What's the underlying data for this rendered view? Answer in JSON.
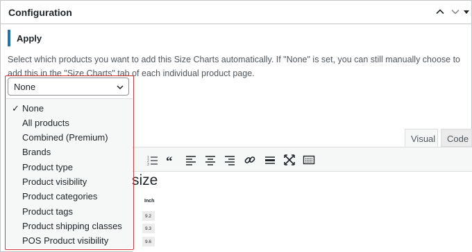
{
  "panel": {
    "title": "Configuration",
    "collapse_icon": "chevron-up-icon",
    "expand_icon": "chevron-down-icon",
    "toggle_icon": "triangle-down-icon"
  },
  "apply": {
    "title": "Apply",
    "description": "Select which products you want to add this Size Charts automatically. If \"None\" is set, you can still manually choose to add this in the \"Size Charts\" tab of each individual product page.",
    "select": {
      "value": "None",
      "options": [
        {
          "label": "None",
          "selected": true
        },
        {
          "label": "All products",
          "selected": false
        },
        {
          "label": "Combined (Premium)",
          "selected": false
        },
        {
          "label": "Brands",
          "selected": false
        },
        {
          "label": "Product type",
          "selected": false
        },
        {
          "label": "Product visibility",
          "selected": false
        },
        {
          "label": "Product categories",
          "selected": false
        },
        {
          "label": "Product tags",
          "selected": false
        },
        {
          "label": "Product shipping classes",
          "selected": false
        },
        {
          "label": "POS Product visibility",
          "selected": false
        }
      ],
      "check_mark": "✓"
    },
    "accent_color": "#2271b1",
    "highlight_color": "#d63638"
  },
  "editor": {
    "tabs": {
      "visual": "Visual",
      "code": "Code"
    },
    "toolbar_icons": [
      "numbered-list-icon",
      "blockquote-icon",
      "align-left-icon",
      "align-center-icon",
      "align-right-icon",
      "link-icon",
      "horizontal-rule-icon",
      "fullscreen-icon",
      "toolbar-toggle-icon"
    ],
    "content": {
      "heading": "size",
      "table_header": "Inch",
      "values": [
        "9.2",
        "9.3",
        "9.6"
      ]
    }
  }
}
